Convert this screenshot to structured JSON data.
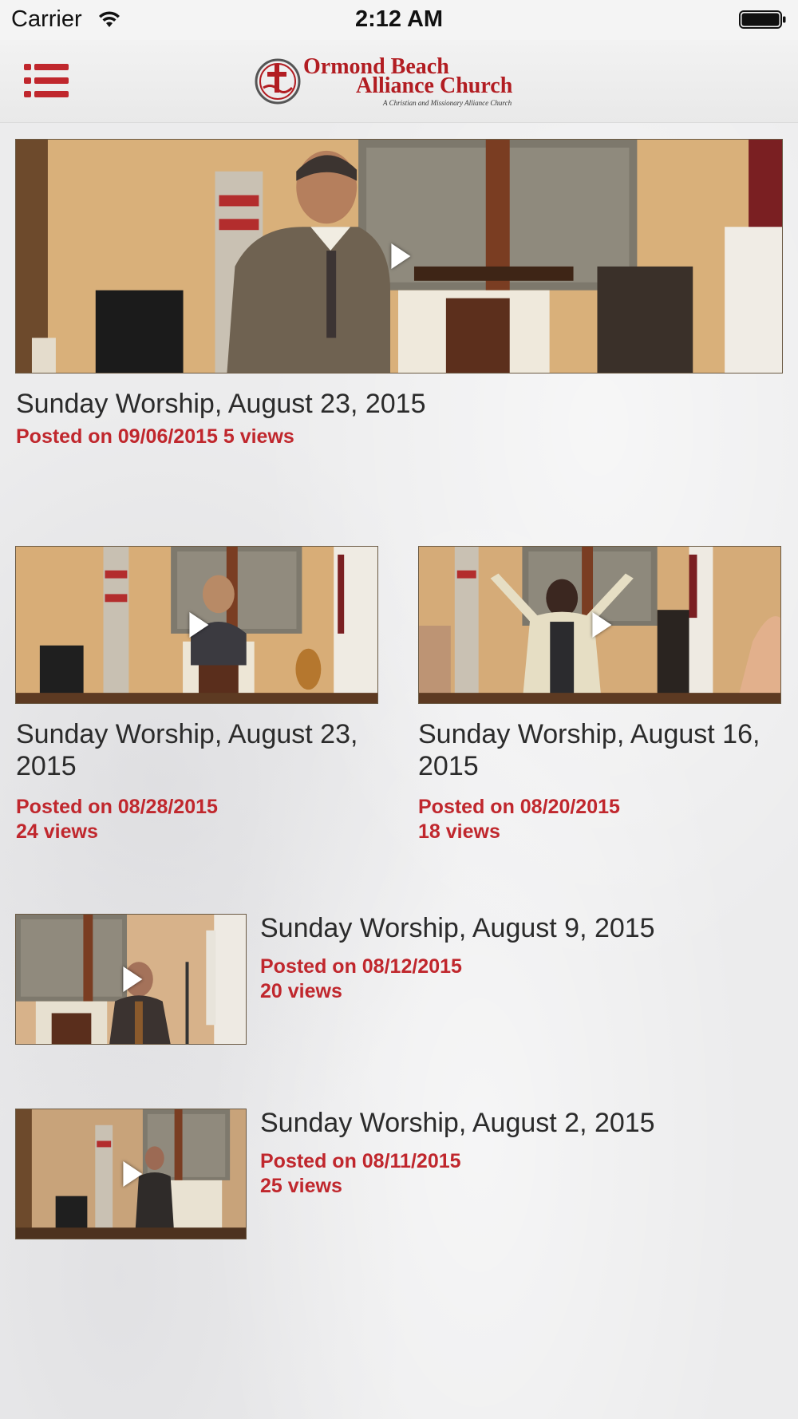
{
  "status_bar": {
    "carrier": "Carrier",
    "time": "2:12 AM"
  },
  "header": {
    "logo_line1": "Ormond Beach",
    "logo_line2": "Alliance Church",
    "logo_tagline": "A Christian and Missionary Alliance Church",
    "menu_icon": "list-menu-icon"
  },
  "colors": {
    "accent": "#c0272d",
    "title_text": "#2b2b2b",
    "background": "#ececed"
  },
  "videos": [
    {
      "title": "Sunday Worship, August 23, 2015",
      "posted": "Posted on 09/06/2015",
      "views": "5 views"
    },
    {
      "title": "Sunday Worship, August 23, 2015",
      "posted": "Posted on 08/28/2015",
      "views": "24 views"
    },
    {
      "title": "Sunday Worship, August 16, 2015",
      "posted": "Posted on 08/20/2015",
      "views": "18 views"
    },
    {
      "title": "Sunday Worship, August 9, 2015",
      "posted": "Posted on 08/12/2015",
      "views": "20 views"
    },
    {
      "title": "Sunday Worship, August 2, 2015",
      "posted": "Posted on 08/11/2015",
      "views": "25 views"
    }
  ]
}
